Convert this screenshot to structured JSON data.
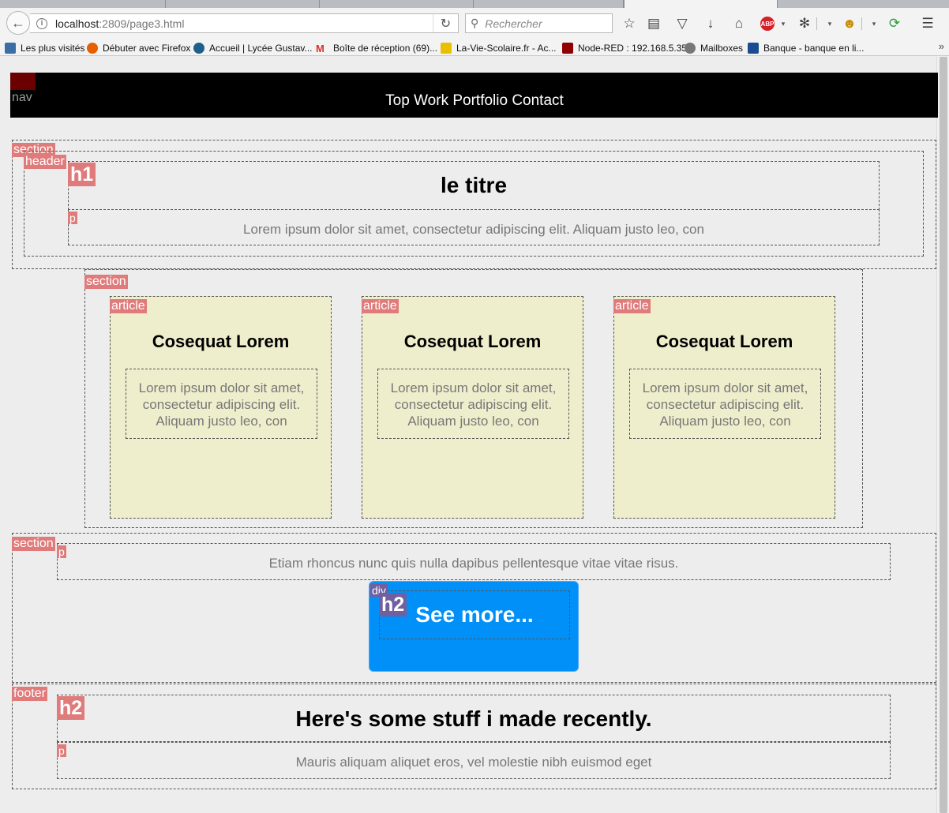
{
  "browser": {
    "url_host": "localhost",
    "url_path": ":2809/page3.html",
    "search_placeholder": "Rechercher",
    "bookmarks": [
      {
        "label": "Les plus visités",
        "color": "#3a6ea5"
      },
      {
        "label": "Débuter avec Firefox",
        "color": "#e66000"
      },
      {
        "label": "Accueil | Lycée Gustav...",
        "color": "#1e5f8c"
      },
      {
        "label": "Boîte de réception (69)...",
        "color": "#d93025"
      },
      {
        "label": "La-Vie-Scolaire.fr - Ac...",
        "color": "#e8c000"
      },
      {
        "label": "Node-RED : 192.168.5.35",
        "color": "#8f0000"
      },
      {
        "label": "Mailboxes",
        "color": "#777777"
      },
      {
        "label": "Banque - banque en li...",
        "color": "#1a4d8f"
      }
    ],
    "bookmark_overflow": "»"
  },
  "page": {
    "nav": {
      "tag": "nav",
      "links": "Top Work Portfolio Contact"
    },
    "section1": {
      "tag": "section",
      "header_tag": "header",
      "h1_tag": "h1",
      "title": "le titre",
      "p_tag": "p",
      "text": "Lorem ipsum dolor sit amet, consectetur adipiscing elit. Aliquam justo leo, con"
    },
    "section2": {
      "tag": "section",
      "articles": [
        {
          "tag": "article",
          "title": "Cosequat Lorem",
          "text": "Lorem ipsum dolor sit amet, consectetur adipiscing elit. Aliquam justo leo, con"
        },
        {
          "tag": "article",
          "title": "Cosequat Lorem",
          "text": "Lorem ipsum dolor sit amet, consectetur adipiscing elit. Aliquam justo leo, con"
        },
        {
          "tag": "article",
          "title": "Cosequat Lorem",
          "text": "Lorem ipsum dolor sit amet, consectetur adipiscing elit. Aliquam justo leo, con"
        }
      ]
    },
    "section3": {
      "tag": "section",
      "p_tag": "p",
      "text": "Etiam rhoncus nunc quis nulla dapibus pellentesque vitae vitae risus.",
      "div_tag": "div",
      "h2_tag": "h2",
      "button": "See more..."
    },
    "footer": {
      "tag": "footer",
      "h2_tag": "h2",
      "title": "Here's some stuff i made recently.",
      "p_tag": "p",
      "text": "Mauris aliquam aliquet eros, vel molestie nibh euismod eget"
    }
  },
  "colors": {
    "article_bg": "#efeecc",
    "button_bg": "#0090f8",
    "tag_bg": "#e07b7b",
    "nav_bg": "#000000"
  }
}
